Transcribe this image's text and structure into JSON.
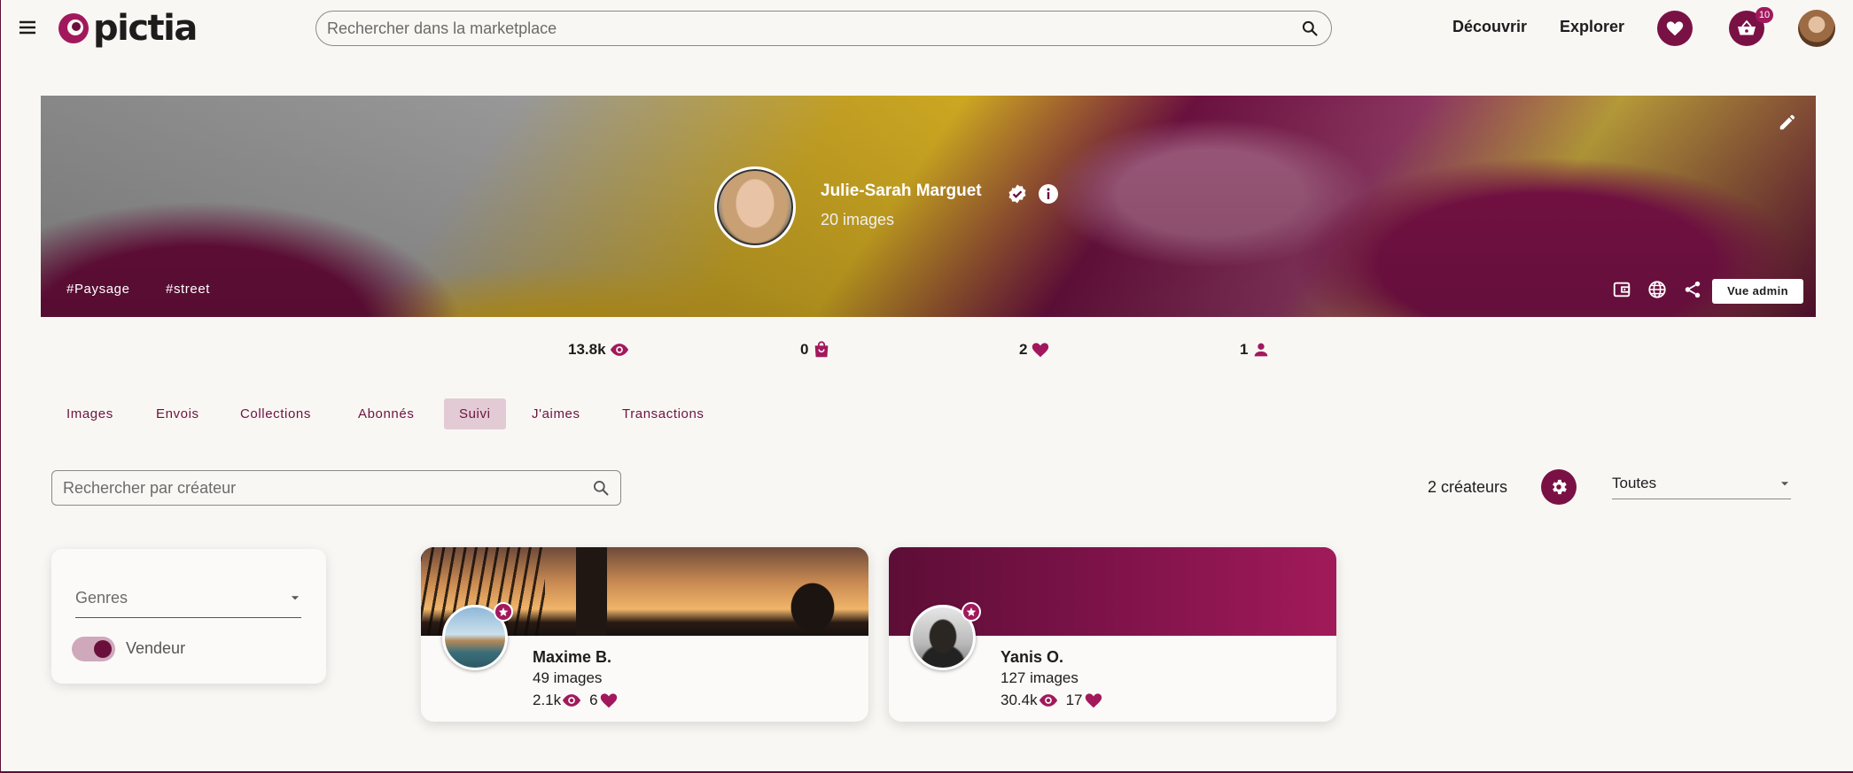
{
  "header": {
    "logo_text": "pictia",
    "search_placeholder": "Rechercher dans la marketplace",
    "nav": [
      "Découvrir",
      "Explorer"
    ],
    "cart_badge": "10"
  },
  "profile": {
    "name": "Julie-Sarah Marguet",
    "images": "20 images",
    "tags": [
      "#Paysage",
      "#street"
    ],
    "admin_button": "Vue admin"
  },
  "stats": {
    "views": "13.8k",
    "purchases": "0",
    "likes": "2",
    "followers": "1"
  },
  "tabs": [
    {
      "label": "Images",
      "active": false
    },
    {
      "label": "Envois",
      "active": false
    },
    {
      "label": "Collections",
      "active": false
    },
    {
      "label": "Abonnés",
      "active": false
    },
    {
      "label": "Suivi",
      "active": true
    },
    {
      "label": "J'aimes",
      "active": false
    },
    {
      "label": "Transactions",
      "active": false
    }
  ],
  "filters": {
    "search_placeholder": "Rechercher par créateur",
    "count": "2 créateurs",
    "select_value": "Toutes",
    "genres_label": "Genres",
    "seller_toggle_label": "Vendeur",
    "seller_toggle_on": true
  },
  "creators": [
    {
      "name": "Maxime B.",
      "images": "49 images",
      "views": "2.1k",
      "likes": "6"
    },
    {
      "name": "Yanis O.",
      "images": "127 images",
      "views": "30.4k",
      "likes": "17"
    }
  ],
  "colors": {
    "brand": "#7a1145",
    "accent": "#a1195c",
    "tab_active_bg": "#e2cbd5",
    "background": "#f9f7f4"
  }
}
